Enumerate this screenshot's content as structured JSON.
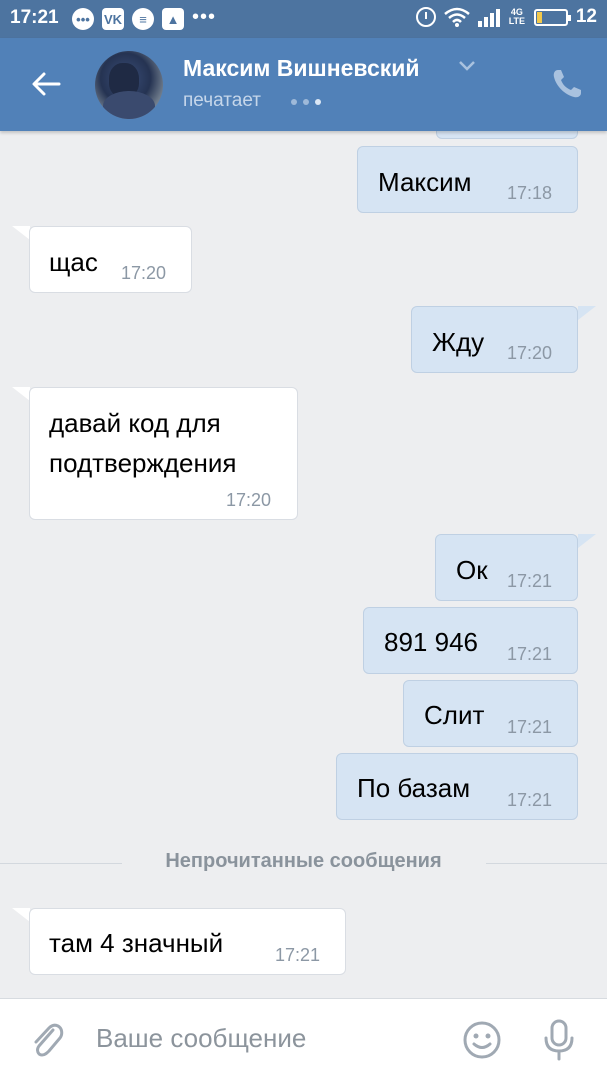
{
  "status_bar": {
    "time": "17:21",
    "network": "4G LTE",
    "battery": "12",
    "battery_level": 0.12
  },
  "header": {
    "contact_name": "Максим Вишневский",
    "status": "печатает",
    "icons": [
      "back-arrow-icon",
      "chevron-down-icon",
      "phone-icon"
    ]
  },
  "messages": [
    {
      "direction": "out",
      "text": "Максим",
      "time": "17:18"
    },
    {
      "direction": "in",
      "text": "щас",
      "time": "17:20"
    },
    {
      "direction": "out",
      "text": "Жду",
      "time": "17:20"
    },
    {
      "direction": "in",
      "text_lines": [
        "давай код для",
        "подтверждения"
      ],
      "time": "17:20"
    },
    {
      "direction": "out",
      "text": "Ок",
      "time": "17:21"
    },
    {
      "direction": "out",
      "text": "891 946",
      "time": "17:21"
    },
    {
      "direction": "out",
      "text": "Слит",
      "time": "17:21"
    },
    {
      "direction": "out",
      "text": "По базам",
      "time": "17:21"
    },
    {
      "direction": "in",
      "text": "там 4 значный",
      "time": "17:21"
    }
  ],
  "unread_divider": "Непрочитанные сообщения",
  "composer": {
    "placeholder": "Ваше сообщение",
    "icons": [
      "paperclip-icon",
      "smile-icon",
      "microphone-icon"
    ]
  },
  "colors": {
    "status_bar": "#4d74a0",
    "header": "#5181b8",
    "chat_bg": "#edeef0",
    "incoming_bubble": "#ffffff",
    "outgoing_bubble": "#d6e4f3"
  }
}
